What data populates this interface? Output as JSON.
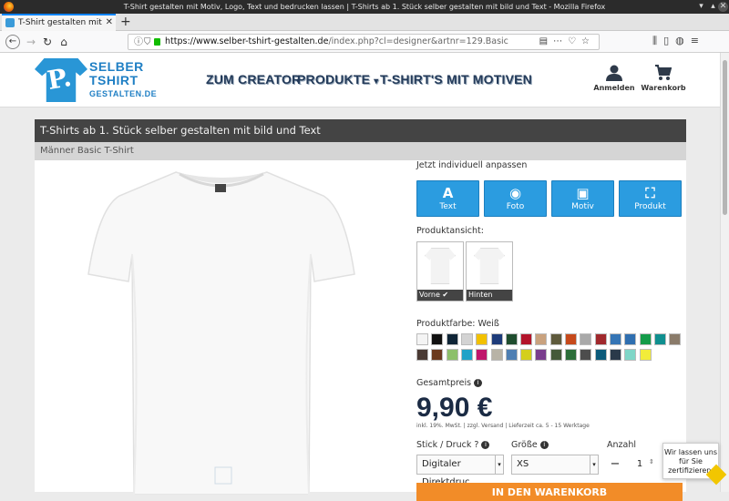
{
  "browser": {
    "window_title": "T-Shirt gestalten mit Motiv, Logo, Text und bedrucken lassen | T-Shirts ab 1. Stück selber gestalten mit bild und Text - Mozilla Firefox",
    "tab_title": "T-Shirt gestalten mit",
    "url_host": "https://www.selber-tshirt-gestalten.de",
    "url_path": "/index.php?cl=designer&artnr=129.Basic"
  },
  "logo": {
    "line1": "SELBER",
    "line2": "TSHIRT",
    "line3": "GESTALTEN.DE",
    "mark": "P."
  },
  "nav": {
    "creator": "ZUM CREATOR",
    "products": "PRODUKTE",
    "motifs": "T-SHIRT'S MIT MOTIVEN"
  },
  "header_actions": {
    "login": "Anmelden",
    "cart": "Warenkorb"
  },
  "panel": {
    "title": "T-Shirts ab 1. Stück selber gestalten mit bild und Text",
    "subtitle": "Männer Basic T-Shirt"
  },
  "customize": {
    "label": "Jetzt individuell anpassen",
    "buttons": [
      {
        "label": "Text",
        "icon": "text-icon",
        "glyph": "A"
      },
      {
        "label": "Foto",
        "icon": "camera-icon",
        "glyph": "◉"
      },
      {
        "label": "Motiv",
        "icon": "image-icon",
        "glyph": "▣"
      },
      {
        "label": "Produkt",
        "icon": "expand-icon",
        "glyph": "⛶"
      }
    ]
  },
  "views": {
    "label": "Produktansicht:",
    "front": "Vorne ✔",
    "back": "Hinten"
  },
  "color": {
    "label": "Produktfarbe: Weiß",
    "swatches": [
      "#f4f4f4",
      "#111111",
      "#0f2537",
      "#d3d3d3",
      "#f2c100",
      "#1d3b7a",
      "#1f4d2e",
      "#b3142b",
      "#c9a27e",
      "#5e5a3c",
      "#c6491b",
      "#a9a9a9",
      "#a0282c",
      "#3575b5",
      "#2f6fb0",
      "#149b49",
      "#0f8f8f",
      "#8a7b6a",
      "#4a3a33",
      "#6b3a1e",
      "#8dc06a",
      "#1fa2c8",
      "#c0156b",
      "#b8b3a6",
      "#4e7fb3",
      "#d4cf1c",
      "#7a3e8e",
      "#455a3a",
      "#2c6e3a",
      "#4d4d4d",
      "#0b5a7a",
      "#2a3a4a",
      "#7fd6c8",
      "#f2ec3a"
    ]
  },
  "price": {
    "label": "Gesamtpreis",
    "value": "9,90 €",
    "fine_print": "inkl. 19%. MwSt. | zzgl. Versand | Lieferzeit ca. 5 - 15 Werktage"
  },
  "options": {
    "print_label": "Stick / Druck ?",
    "print_value": "Digitaler Direktdruc",
    "size_label": "Größe",
    "size_value": "XS",
    "qty_label": "Anzahl",
    "qty_value": "1"
  },
  "cta": {
    "label": "IN DEN WARENKORB"
  },
  "badge": {
    "text": "Wir lassen uns für Sie zertifizieren."
  }
}
